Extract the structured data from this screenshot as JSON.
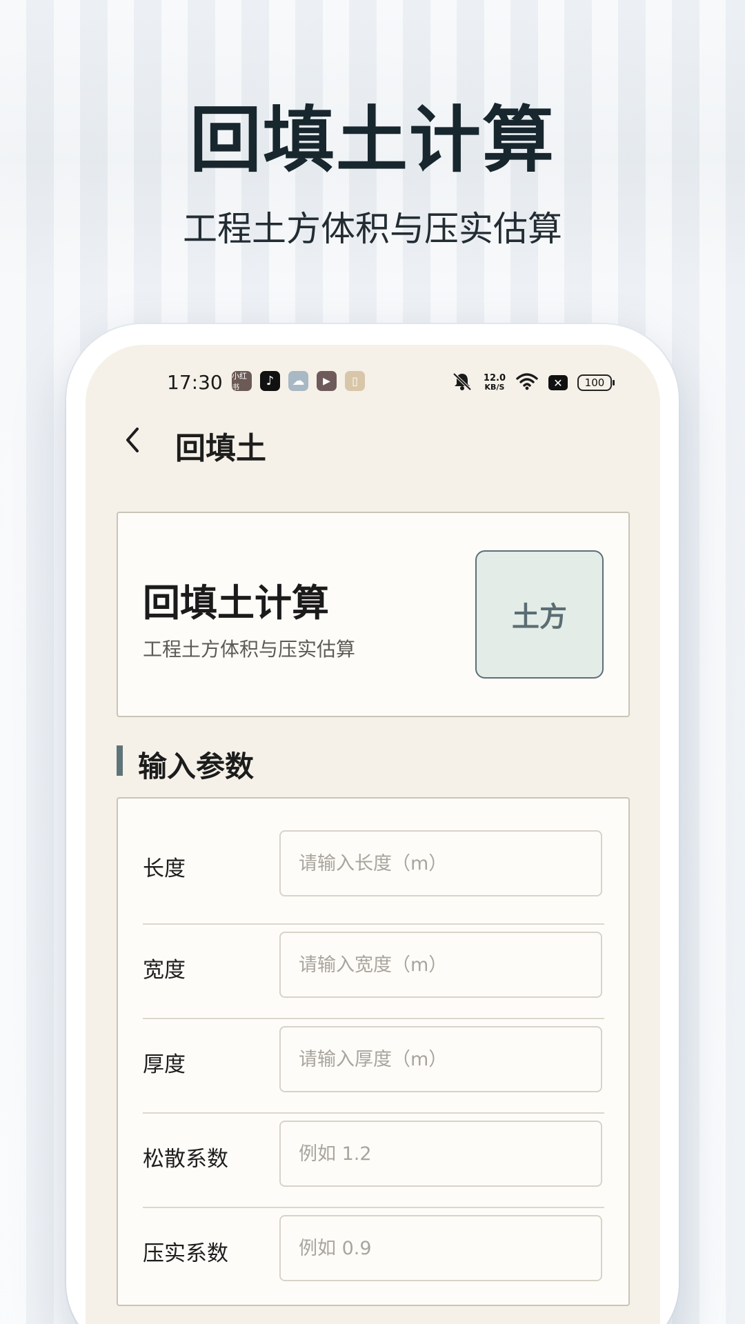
{
  "promo": {
    "title": "回填土计算",
    "subtitle": "工程土方体积与压实估算"
  },
  "status_bar": {
    "time": "17:30",
    "net_speed_value": "12.0",
    "net_speed_unit": "KB/S",
    "battery": "100",
    "app_icons": [
      {
        "name": "xiaohongshu-icon",
        "label": "小红书",
        "color": "#6b5a55"
      },
      {
        "name": "tiktok-icon",
        "label": "♪",
        "color": "#111111"
      },
      {
        "name": "weather-icon",
        "label": "☁",
        "color": "#a8b8c4"
      },
      {
        "name": "video-icon",
        "label": "▶",
        "color": "#6e5a5a"
      },
      {
        "name": "reader-icon",
        "label": "▯",
        "color": "#d8c6a8"
      }
    ]
  },
  "nav": {
    "title": "回填土"
  },
  "header_card": {
    "title": "回填土计算",
    "subtitle": "工程土方体积与压实估算",
    "badge": "土方"
  },
  "section": {
    "title": "输入参数"
  },
  "form": {
    "rows": [
      {
        "label": "长度",
        "placeholder": "请输入长度（m）"
      },
      {
        "label": "宽度",
        "placeholder": "请输入宽度（m）"
      },
      {
        "label": "厚度",
        "placeholder": "请输入厚度（m）"
      },
      {
        "label": "松散系数",
        "placeholder": "例如 1.2"
      },
      {
        "label": "压实系数",
        "placeholder": "例如 0.9"
      }
    ]
  },
  "colors": {
    "accent": "#5f7478",
    "screen_bg": "#f5f1e8",
    "card_bg": "#fdfcf8",
    "badge_bg": "#e3ece7"
  }
}
